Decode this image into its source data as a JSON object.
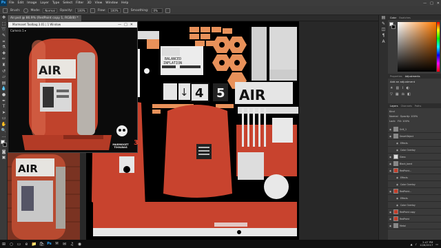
{
  "app": {
    "logo": "Ps"
  },
  "menu": [
    "File",
    "Edit",
    "Image",
    "Layer",
    "Type",
    "Select",
    "Filter",
    "3D",
    "View",
    "Window",
    "Help"
  ],
  "window_controls": [
    "—",
    "□",
    "✕"
  ],
  "options": {
    "brush_label": "Brush:",
    "mode_label": "Mode:",
    "mode_value": "Normal",
    "opacity_label": "Opacity:",
    "opacity_value": "100%",
    "flow_label": "Flow:",
    "flow_value": "100%",
    "smoothing_label": "Smoothing:",
    "smoothing_value": "0%"
  },
  "document_tab": "Air.psd @ 86.9% (RedPaint copy 1, RGB/8) *",
  "toolbag": {
    "title": "Marmoset Toolbag 3.01 | 1 Window",
    "camera": "Camera 1 ▾",
    "logo_line1": "MARMOSET",
    "logo_line2": "TOOLBAG",
    "logo_num": "3"
  },
  "texture": {
    "air": "AIR",
    "num4": "4",
    "num5": "5",
    "balanced": "BALANCED",
    "inflation": "INFLATION",
    "arrow": "↓"
  },
  "pump_label": "AIR",
  "photo_label": "AIR",
  "color_panel": {
    "tabs": [
      "Color",
      "Swatches"
    ],
    "fg": "#f0f0f0",
    "bg": "#111111"
  },
  "adjust_panel": {
    "tabs": [
      "Properties",
      "Adjustments"
    ],
    "title": "Add an adjustment"
  },
  "layers_panel": {
    "tabs": [
      "Layers",
      "Channels",
      "Paths"
    ],
    "kind": "Kind",
    "blend": "Normal",
    "opacity": "Opacity: 100%",
    "fill": "Fill: 100%",
    "lock": "Lock:",
    "layers": [
      {
        "name": "Grill_1",
        "thumb": "g"
      },
      {
        "name": "SmartObject",
        "thumb": "g"
      },
      {
        "name": "Effects",
        "thumb": ""
      },
      {
        "name": "Color Overlay",
        "thumb": ""
      },
      {
        "name": "Glass",
        "thumb": "w"
      },
      {
        "name": "Black_band",
        "thumb": "g"
      },
      {
        "name": "RedPaint...",
        "thumb": "r"
      },
      {
        "name": "Effects",
        "thumb": ""
      },
      {
        "name": "Color Overlay",
        "thumb": ""
      },
      {
        "name": "RedPaint...",
        "thumb": "r"
      },
      {
        "name": "Effects",
        "thumb": ""
      },
      {
        "name": "Color Overlay",
        "thumb": ""
      },
      {
        "name": "RedPaint copy",
        "thumb": "r"
      },
      {
        "name": "RedPaint",
        "thumb": "r"
      },
      {
        "name": "Metal",
        "thumb": "g"
      }
    ]
  },
  "taskbar": {
    "icons": [
      "⊞",
      "○",
      "▭",
      "e",
      "📁",
      "🛍",
      "Ps",
      "M",
      "✉",
      "♫",
      "◉"
    ],
    "time": "2:47 PM",
    "date": "12/6/2017"
  }
}
